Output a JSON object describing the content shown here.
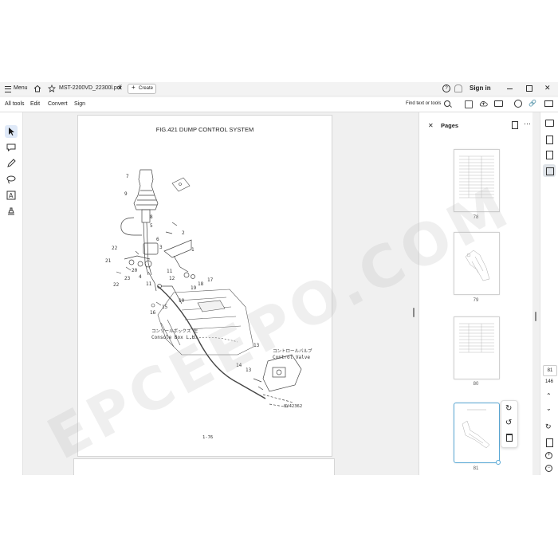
{
  "tabbar": {
    "menu_label": "Menu",
    "tab_title": "MST-2200VD_22300l.pdf",
    "create_label": "Create",
    "sign_in_label": "Sign in"
  },
  "toolbar": {
    "items": [
      "All tools",
      "Edit",
      "Convert",
      "Sign"
    ],
    "find_label": "Find text or tools"
  },
  "document": {
    "figure_title": "FIG.421 DUMP CONTROL SYSTEM",
    "part_numbers": [
      "7",
      "9",
      "8",
      "5",
      "6",
      "2",
      "3",
      "1",
      "22",
      "21",
      "20",
      "4",
      "23",
      "22",
      "11",
      "11",
      "12",
      "17",
      "18",
      "19",
      "16",
      "15",
      "10",
      "13",
      "14",
      "13"
    ],
    "annotation_console_jp": "コンソールボックス 左",
    "annotation_console_en": "Console Box L.H.",
    "annotation_valve_jp": "コントロールバルブ",
    "annotation_valve_en": "Control Valve",
    "drawing_code": "8V42362",
    "page_ref": "1-76"
  },
  "pages_panel": {
    "title": "Pages",
    "thumbnails": [
      {
        "label": "78"
      },
      {
        "label": "79"
      },
      {
        "label": "80"
      },
      {
        "label": "81"
      }
    ]
  },
  "right_rail": {
    "current_page": "81",
    "total_pages": "146"
  },
  "watermark": "EPCEEPO.COM",
  "colors": {
    "accent": "#1473e6",
    "selected_thumb_border": "#5aa9d6",
    "tool_active_bg": "#dfe9f8"
  }
}
